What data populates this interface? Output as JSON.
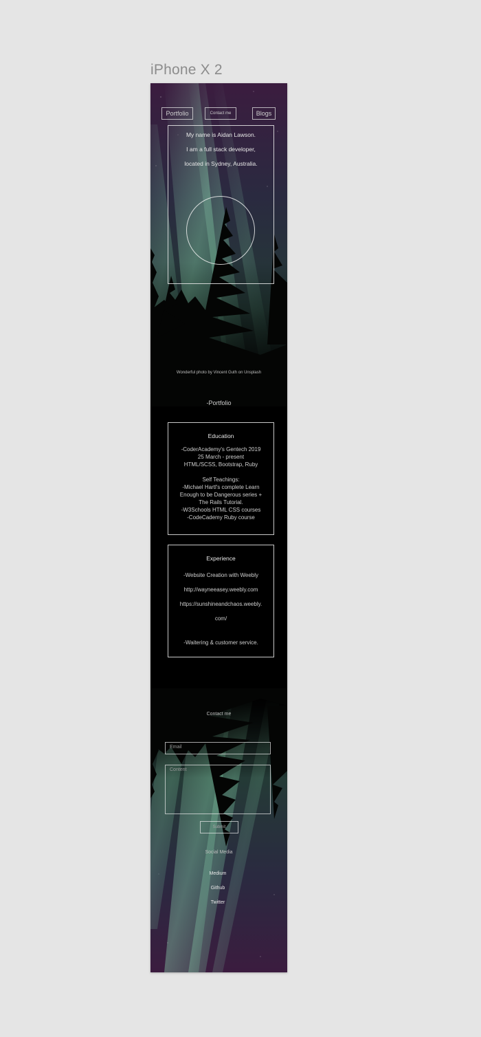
{
  "artboard": {
    "title": "iPhone X 2"
  },
  "nav": {
    "portfolio": "Portfolio",
    "contact": "Contact me",
    "blogs": "Blogs"
  },
  "intro": {
    "line1": "My name is Aidan Lawson.",
    "line2": "I am a full stack developer,",
    "line3": "located in Sydney, Australia."
  },
  "photo_credit": "Wonderful photo by Vincent Guth on Unsplash",
  "portfolio_heading": "-Portfolio",
  "education": {
    "title": "Education",
    "lines": [
      "-CoderAcademy's Gentech 2019",
      "25 March - present",
      "HTML/SCSS, Bootstrap, Ruby",
      "",
      "Self Teachings:",
      "-Michael Hartl's complete Learn",
      "Enough to be Dangerous series +",
      "The Rails Tutorial.",
      "-W3Schools HTML CSS courses",
      "-CodeCademy Ruby course"
    ]
  },
  "experience": {
    "title": "Experience",
    "line1": "-Website Creation with Weebly",
    "line2": "http://wayneeasey.weebly.com",
    "line3": "https://sunshineandchaos.weebly.",
    "line4": "com/",
    "line5": "-Waitering & customer service."
  },
  "contact": {
    "heading": "Contact me",
    "email_placeholder": "Email",
    "message_placeholder": "Content",
    "submit": "Submit"
  },
  "social": {
    "heading": "Social Media",
    "links": [
      "Medium",
      "Github",
      "Twitter"
    ]
  },
  "colors": {
    "aurora_green": "#7fd3a8",
    "aurora_purple": "#3a2044",
    "background": "#000000",
    "canvas": "#e5e5e5"
  }
}
